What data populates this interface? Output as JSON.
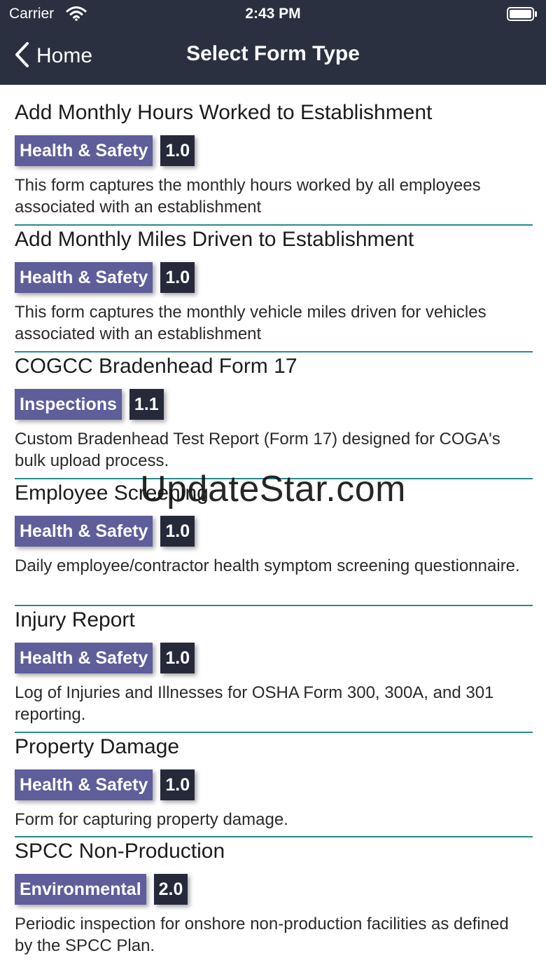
{
  "status_bar": {
    "carrier": "Carrier",
    "time": "2:43 PM"
  },
  "nav": {
    "back_label": "Home",
    "title": "Select Form Type"
  },
  "forms": [
    {
      "title": "Add Monthly Hours Worked to Establishment",
      "category": "Health & Safety",
      "version": "1.0",
      "description": "This form captures the monthly hours worked by all employees associated with an establishment"
    },
    {
      "title": "Add Monthly Miles Driven to Establishment",
      "category": "Health & Safety",
      "version": "1.0",
      "description": "This form captures the monthly vehicle miles driven for vehicles associated with an establishment"
    },
    {
      "title": "COGCC Bradenhead Form 17",
      "category": "Inspections",
      "version": "1.1",
      "description": "Custom Bradenhead Test Report (Form 17) designed for COGA's bulk upload process."
    },
    {
      "title": "Employee Screening",
      "category": "Health & Safety",
      "version": "1.0",
      "description": "Daily employee/contractor health symptom screening questionnaire."
    },
    {
      "title": "Injury Report",
      "category": "Health & Safety",
      "version": "1.0",
      "description": "Log of Injuries and Illnesses for OSHA Form 300, 300A, and 301 reporting."
    },
    {
      "title": "Property Damage",
      "category": "Health & Safety",
      "version": "1.0",
      "description": "Form for capturing property damage."
    },
    {
      "title": "SPCC Non-Production",
      "category": "Environmental",
      "version": "2.0",
      "description": "Periodic inspection for onshore non-production facilities as defined by the SPCC Plan."
    }
  ],
  "watermark": "UpdateStar.com",
  "colors": {
    "nav_background": "#2b3040",
    "category_badge": "#5d5e9a",
    "version_badge": "#26293a",
    "separator": "#2a8a8f"
  },
  "icons": {
    "wifi": "wifi-icon",
    "battery": "battery-icon",
    "back": "chevron-left-icon"
  }
}
